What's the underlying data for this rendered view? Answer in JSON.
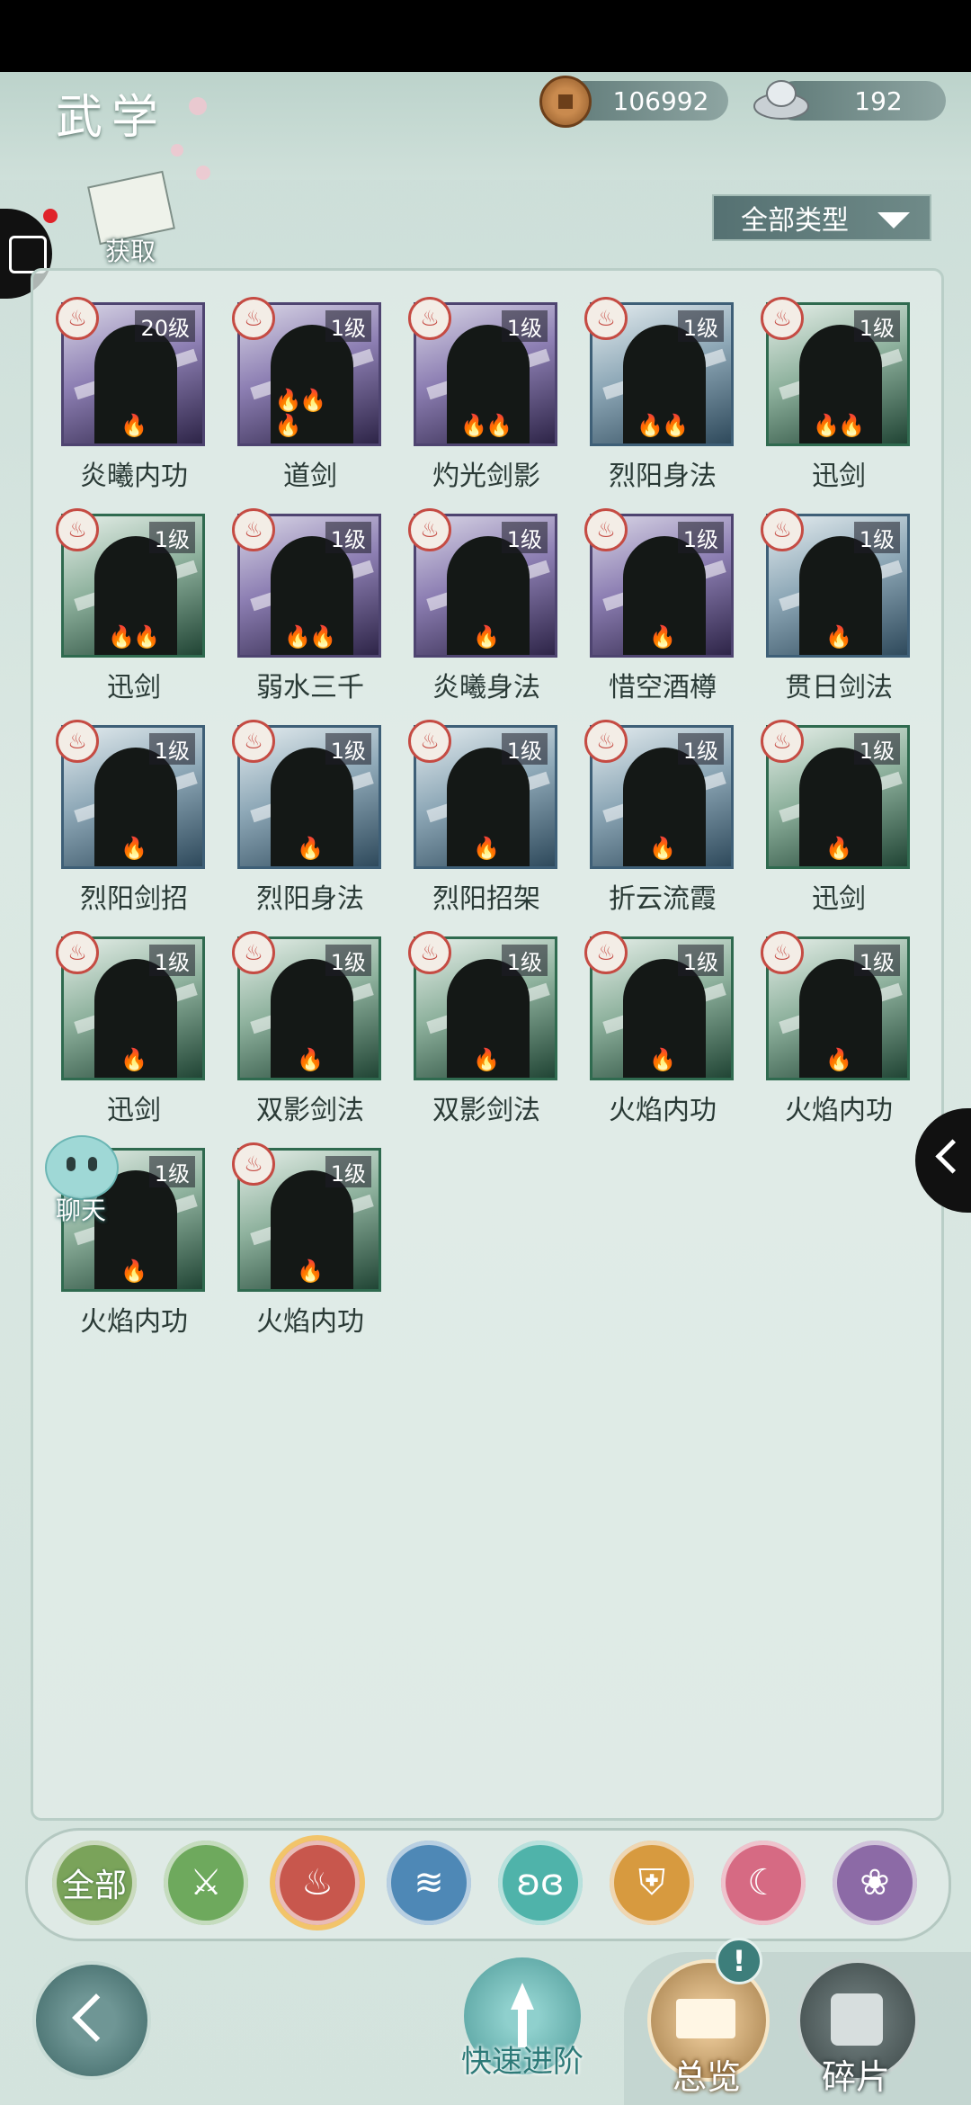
{
  "header": {
    "title": "武学",
    "copper": "106992",
    "silver": "192",
    "acquire_label": "获取",
    "filter_label": "全部类型"
  },
  "chat_label": "聊天",
  "skills": [
    {
      "name": "炎曦内功",
      "level": "20级",
      "flames": "🔥",
      "theme": "purple"
    },
    {
      "name": "道剑",
      "level": "1级",
      "flames": "🔥🔥🔥",
      "theme": "purple"
    },
    {
      "name": "灼光剑影",
      "level": "1级",
      "flames": "🔥🔥",
      "theme": "purple"
    },
    {
      "name": "烈阳身法",
      "level": "1级",
      "flames": "🔥🔥",
      "theme": "blue"
    },
    {
      "name": "迅剑",
      "level": "1级",
      "flames": "🔥🔥",
      "theme": "green"
    },
    {
      "name": "迅剑",
      "level": "1级",
      "flames": "🔥🔥",
      "theme": "green"
    },
    {
      "name": "弱水三千",
      "level": "1级",
      "flames": "🔥🔥",
      "theme": "purple"
    },
    {
      "name": "炎曦身法",
      "level": "1级",
      "flames": "🔥",
      "theme": "purple"
    },
    {
      "name": "惜空酒樽",
      "level": "1级",
      "flames": "🔥",
      "theme": "purple"
    },
    {
      "name": "贯日剑法",
      "level": "1级",
      "flames": "🔥",
      "theme": "blue"
    },
    {
      "name": "烈阳剑招",
      "level": "1级",
      "flames": "🔥",
      "theme": "blue"
    },
    {
      "name": "烈阳身法",
      "level": "1级",
      "flames": "🔥",
      "theme": "blue"
    },
    {
      "name": "烈阳招架",
      "level": "1级",
      "flames": "🔥",
      "theme": "blue"
    },
    {
      "name": "折云流霞",
      "level": "1级",
      "flames": "🔥",
      "theme": "blue"
    },
    {
      "name": "迅剑",
      "level": "1级",
      "flames": "🔥",
      "theme": "green"
    },
    {
      "name": "迅剑",
      "level": "1级",
      "flames": "🔥",
      "theme": "green"
    },
    {
      "name": "双影剑法",
      "level": "1级",
      "flames": "🔥",
      "theme": "green"
    },
    {
      "name": "双影剑法",
      "level": "1级",
      "flames": "🔥",
      "theme": "green"
    },
    {
      "name": "火焰内功",
      "level": "1级",
      "flames": "🔥",
      "theme": "green"
    },
    {
      "name": "火焰内功",
      "level": "1级",
      "flames": "🔥",
      "theme": "green"
    },
    {
      "name": "火焰内功",
      "level": "1级",
      "flames": "🔥",
      "theme": "green"
    },
    {
      "name": "火焰内功",
      "level": "1级",
      "flames": "🔥",
      "theme": "green"
    }
  ],
  "categories": [
    {
      "name": "全部",
      "color": "#7aa35a",
      "icon": "all"
    },
    {
      "name": "",
      "color": "#6ea95d",
      "icon": "sword"
    },
    {
      "name": "",
      "color": "#c8574d",
      "icon": "fire",
      "selected": true
    },
    {
      "name": "",
      "color": "#4e88b6",
      "icon": "wave"
    },
    {
      "name": "",
      "color": "#4fb3aa",
      "icon": "butterfly"
    },
    {
      "name": "",
      "color": "#d79a3f",
      "icon": "shield"
    },
    {
      "name": "",
      "color": "#d66a83",
      "icon": "moon"
    },
    {
      "name": "",
      "color": "#8c6aa6",
      "icon": "flower"
    }
  ],
  "bottom": {
    "quick_label": "快速进阶",
    "overview_label": "总览",
    "fragment_label": "碎片",
    "alert": "!"
  },
  "colors": {
    "accent": "#2d7a78",
    "badge_red": "#c54b43"
  }
}
